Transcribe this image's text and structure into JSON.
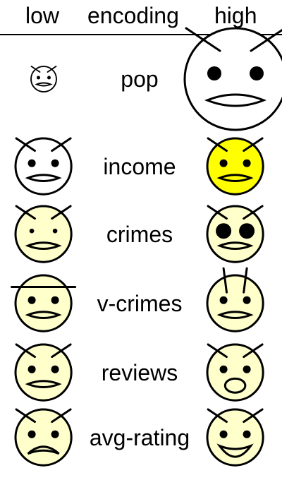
{
  "header": {
    "low": "low",
    "encoding": "encoding",
    "high": "high"
  },
  "colors": {
    "neutral_face": "#ffffff",
    "base_face": "#ffffcc",
    "highlight_face": "#ffff00",
    "stroke": "#000000"
  },
  "rows": [
    {
      "label": "pop",
      "low": {
        "scale": 0.25,
        "fill": "#ffffff",
        "brows": "angry",
        "eyes": "normal",
        "mouth": "flat"
      },
      "high": {
        "scale": 1.0,
        "fill": "#ffffff",
        "brows": "angry",
        "eyes": "normal",
        "mouth": "flat"
      }
    },
    {
      "label": "income",
      "low": {
        "scale": 0.55,
        "fill": "#ffffff",
        "brows": "angry",
        "eyes": "normal",
        "mouth": "flat"
      },
      "high": {
        "scale": 0.55,
        "fill": "#ffff00",
        "brows": "angry",
        "eyes": "normal",
        "mouth": "flat"
      }
    },
    {
      "label": "crimes",
      "low": {
        "scale": 0.55,
        "fill": "#ffffcc",
        "brows": "angry",
        "eyes": "small",
        "mouth": "flat"
      },
      "high": {
        "scale": 0.55,
        "fill": "#ffffcc",
        "brows": "angry",
        "eyes": "big",
        "mouth": "flat"
      }
    },
    {
      "label": "v-crimes",
      "low": {
        "scale": 0.55,
        "fill": "#ffffcc",
        "brows": "flat",
        "eyes": "normal",
        "mouth": "flat"
      },
      "high": {
        "scale": 0.55,
        "fill": "#ffffcc",
        "brows": "vertical",
        "eyes": "normal",
        "mouth": "flat"
      }
    },
    {
      "label": "reviews",
      "low": {
        "scale": 0.55,
        "fill": "#ffffcc",
        "brows": "angry",
        "eyes": "normal",
        "mouth": "flat"
      },
      "high": {
        "scale": 0.55,
        "fill": "#ffffcc",
        "brows": "angry",
        "eyes": "normal",
        "mouth": "open"
      }
    },
    {
      "label": "avg-rating",
      "low": {
        "scale": 0.55,
        "fill": "#ffffcc",
        "brows": "angry",
        "eyes": "normal",
        "mouth": "frown"
      },
      "high": {
        "scale": 0.55,
        "fill": "#ffffcc",
        "brows": "angry",
        "eyes": "normal",
        "mouth": "smile"
      }
    }
  ]
}
